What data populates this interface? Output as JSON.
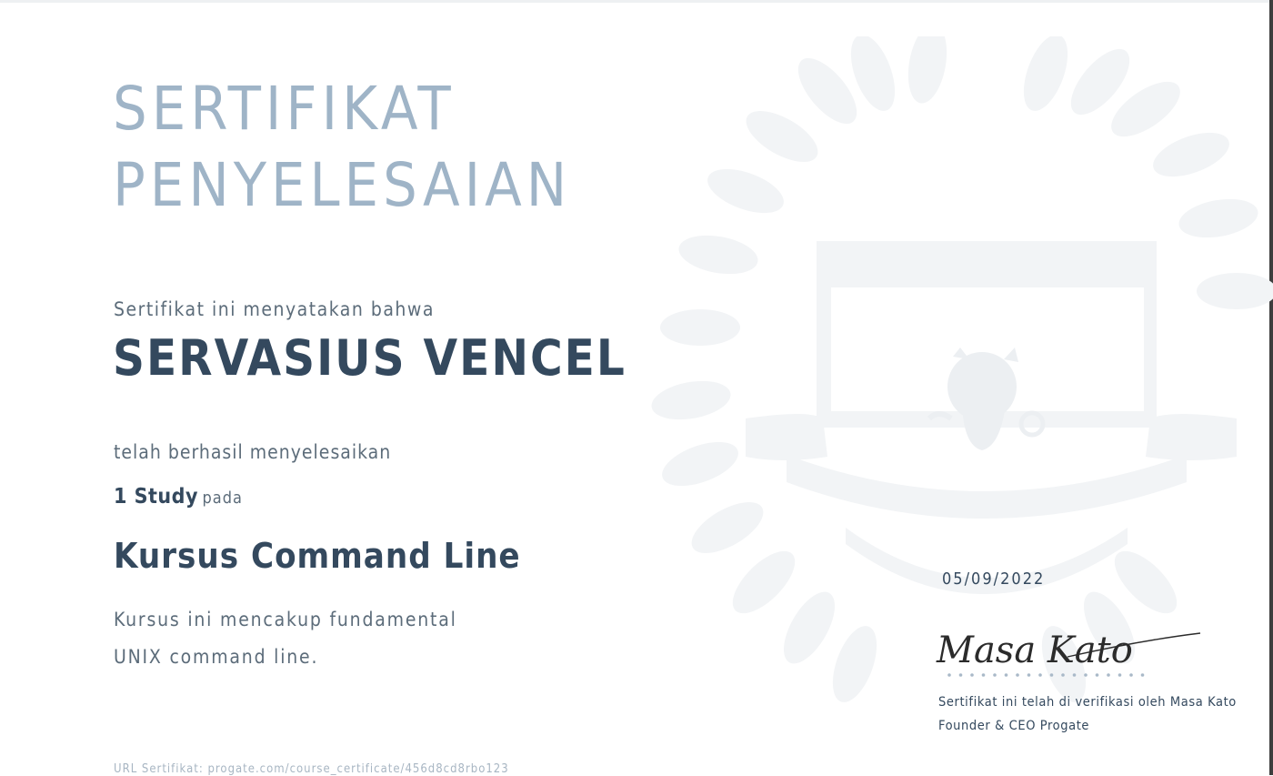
{
  "certificate": {
    "title_line1": "SERTIFIKAT",
    "title_line2": "PENYELESAIAN",
    "intro": "Sertifikat ini menyatakan bahwa",
    "recipient": "SERVASIUS VENCEL",
    "completed_label": "telah berhasil menyelesaikan",
    "study_count": "1 Study",
    "study_suffix": "pada",
    "course_title": "Kursus Command Line",
    "course_description": "Kursus ini mencakup fundamental UNIX command line.",
    "url": "URL Sertifikat: progate.com/course_certificate/456d8cd8rbo123",
    "date": "05/09/2022"
  },
  "verification": {
    "signature_text": "Masa Kato",
    "line1": "Sertifikat ini telah di verifikasi oleh Masa Kato",
    "line2": "Founder & CEO Progate"
  },
  "brand": {
    "name": "progate",
    "icon": "progate-logo-icon"
  },
  "colors": {
    "title": "#9fb4c7",
    "heading": "#34495e",
    "body": "#5c6c7a",
    "watermark": "#f1f3f5"
  }
}
